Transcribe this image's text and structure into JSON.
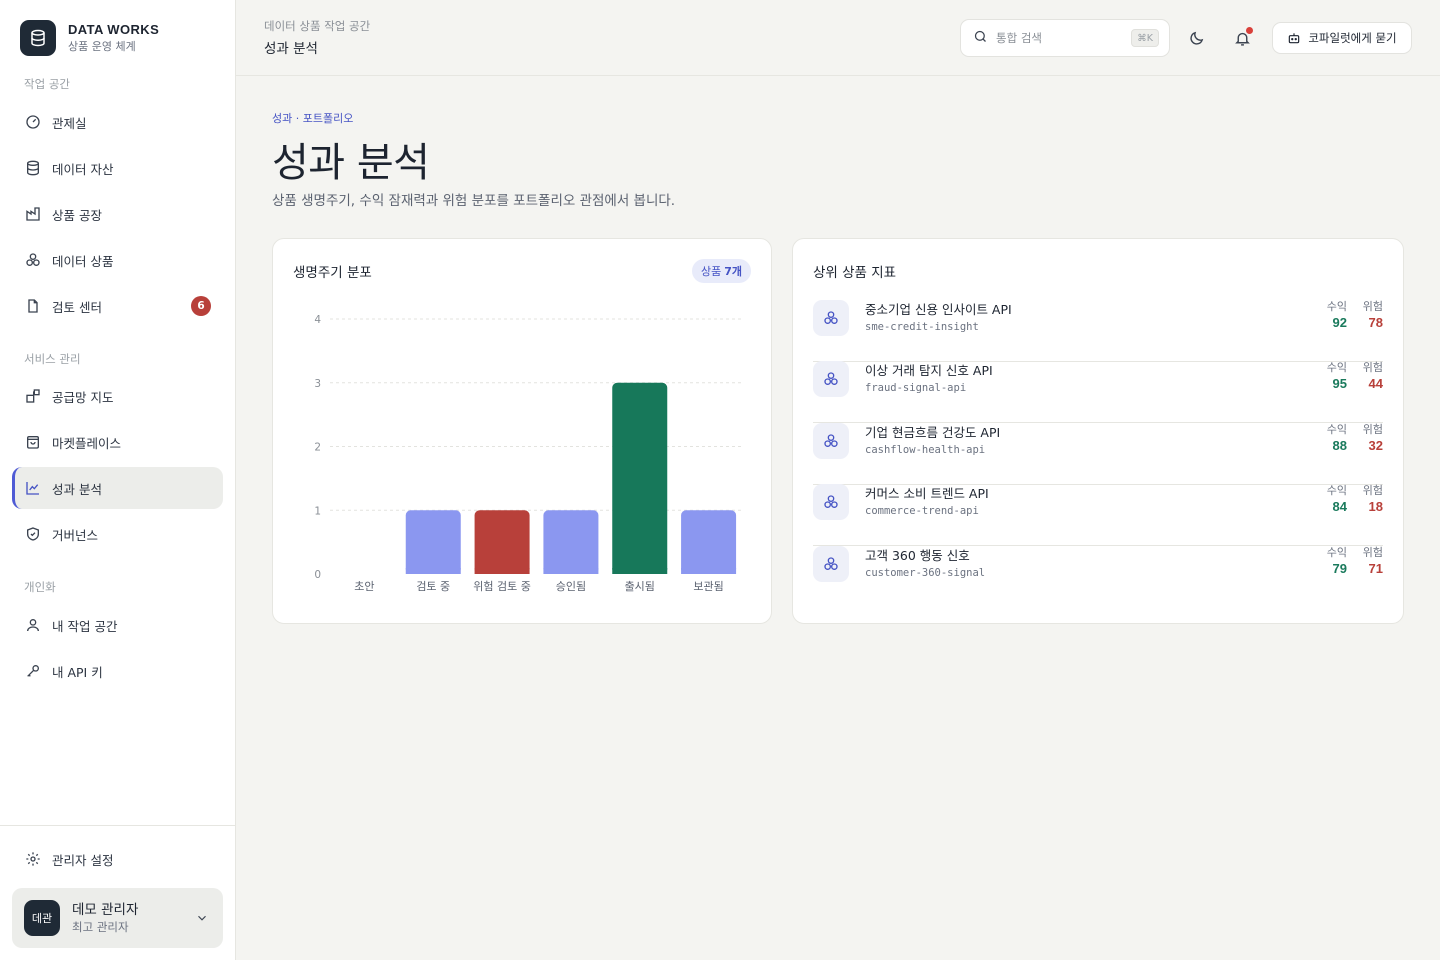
{
  "brand": {
    "title": "DATA WORKS",
    "subtitle": "상품 운영 체계"
  },
  "sidebar": {
    "sections": [
      {
        "label": "작업 공간"
      },
      {
        "label": "서비스 관리"
      },
      {
        "label": "개인화"
      }
    ],
    "items": [
      {
        "label": "관제실",
        "icon": "gauge-icon"
      },
      {
        "label": "데이터 자산",
        "icon": "database-icon"
      },
      {
        "label": "상품 공장",
        "icon": "factory-icon"
      },
      {
        "label": "데이터 상품",
        "icon": "boxes-icon"
      },
      {
        "label": "검토 센터",
        "icon": "file-check-icon",
        "badge": "6"
      },
      {
        "label": "공급망 지도",
        "icon": "blocks-icon"
      },
      {
        "label": "마켓플레이스",
        "icon": "shopping-bag-icon"
      },
      {
        "label": "성과 분석",
        "icon": "chart-line-icon",
        "active": true
      },
      {
        "label": "거버넌스",
        "icon": "shield-check-icon"
      },
      {
        "label": "내 작업 공간",
        "icon": "user-icon"
      },
      {
        "label": "내 API 키",
        "icon": "key-icon"
      },
      {
        "label": "관리자 설정",
        "icon": "gear-icon"
      }
    ],
    "user": {
      "avatar": "데관",
      "name": "데모 관리자",
      "role": "최고 관리자"
    }
  },
  "header": {
    "breadcrumb": "데이터 상품 작업 공간",
    "title": "성과 분석",
    "search_placeholder": "통합 검색",
    "search_shortcut": "⌘K",
    "copilot_label": "코파일럿에게 묻기"
  },
  "main": {
    "tag": "성과 · 포트폴리오",
    "title": "성과 분석",
    "description": "상품 생명주기, 수익 잠재력과 위험 분포를 포트폴리오 관점에서 봅니다."
  },
  "lifecycle_card": {
    "title": "생명주기 분포",
    "pill_prefix": "상품",
    "pill_count": "7개"
  },
  "chart_data": {
    "type": "bar",
    "categories": [
      "초안",
      "검토 중",
      "위험 검토 중",
      "승인됨",
      "출시됨",
      "보관됨"
    ],
    "values": [
      0,
      1,
      1,
      1,
      3,
      1
    ],
    "colors": [
      "#8b97f0",
      "#8b97f0",
      "#b8403a",
      "#8b97f0",
      "#17785a",
      "#8b97f0"
    ],
    "yticks": [
      0,
      1,
      2,
      3,
      4
    ],
    "ylim": [
      0,
      4
    ],
    "grid": true
  },
  "products_card": {
    "title": "상위 상품 지표",
    "revenue_label": "수익",
    "risk_label": "위험",
    "items": [
      {
        "name": "중소기업 신용 인사이트 API",
        "slug": "sme-credit-insight",
        "revenue": "92",
        "risk": "78"
      },
      {
        "name": "이상 거래 탐지 신호 API",
        "slug": "fraud-signal-api",
        "revenue": "95",
        "risk": "44"
      },
      {
        "name": "기업 현금흐름 건강도 API",
        "slug": "cashflow-health-api",
        "revenue": "88",
        "risk": "32"
      },
      {
        "name": "커머스 소비 트렌드 API",
        "slug": "commerce-trend-api",
        "revenue": "84",
        "risk": "18"
      },
      {
        "name": "고객 360 행동 신호",
        "slug": "customer-360-signal",
        "revenue": "79",
        "risk": "71"
      }
    ]
  },
  "colors": {
    "accent": "#4553c4",
    "positive": "#1a7a5c",
    "negative": "#b8403a",
    "sidebar_dark": "#1f2a36"
  }
}
